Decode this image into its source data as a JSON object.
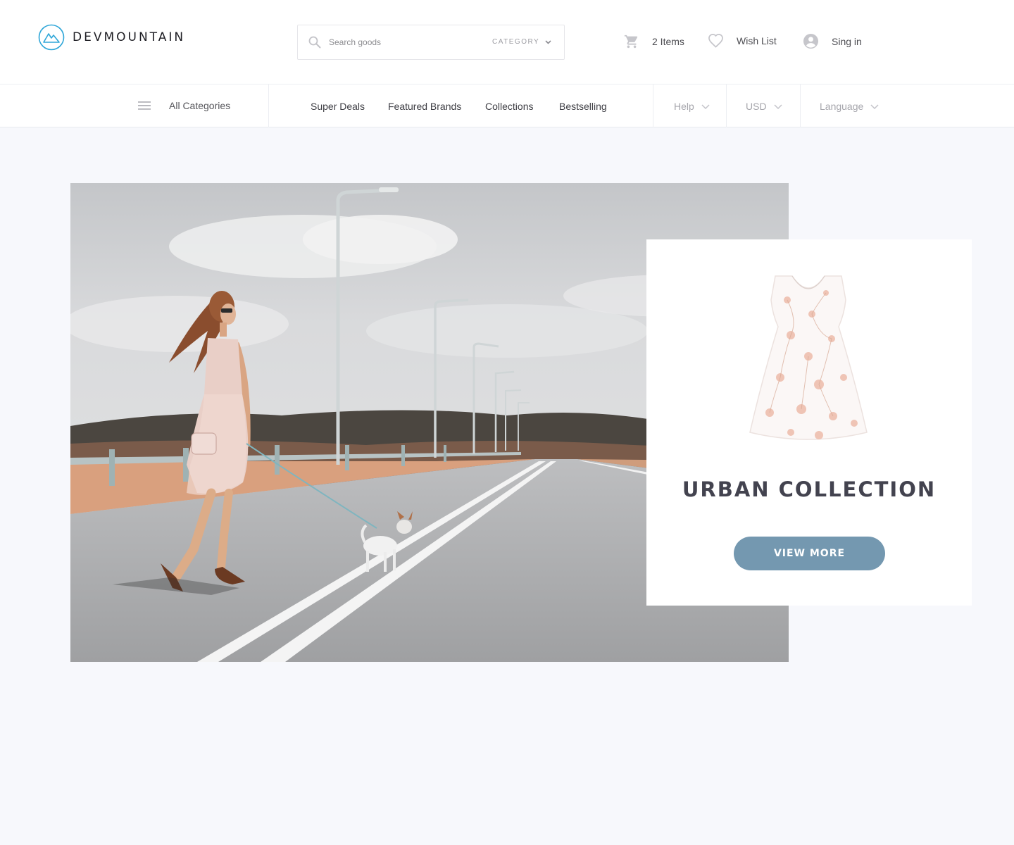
{
  "header": {
    "logo_text": "DEVMOUNTAIN",
    "search": {
      "placeholder": "Search goods",
      "category_label": "CATEGORY"
    },
    "cart_label": "2 Items",
    "wishlist_label": "Wish List",
    "signin_label": "Sing in"
  },
  "nav": {
    "all_categories": "All Categories",
    "links": [
      "Super Deals",
      "Featured Brands",
      "Collections",
      "Bestselling"
    ],
    "help": "Help",
    "currency": "USD",
    "language": "Language"
  },
  "promo": {
    "title": "URBAN COLLECTION",
    "button_label": "VIEW MORE"
  },
  "colors": {
    "accent": "#7498b0",
    "logo": "#2ea6d8",
    "background": "#f7f8fc"
  }
}
